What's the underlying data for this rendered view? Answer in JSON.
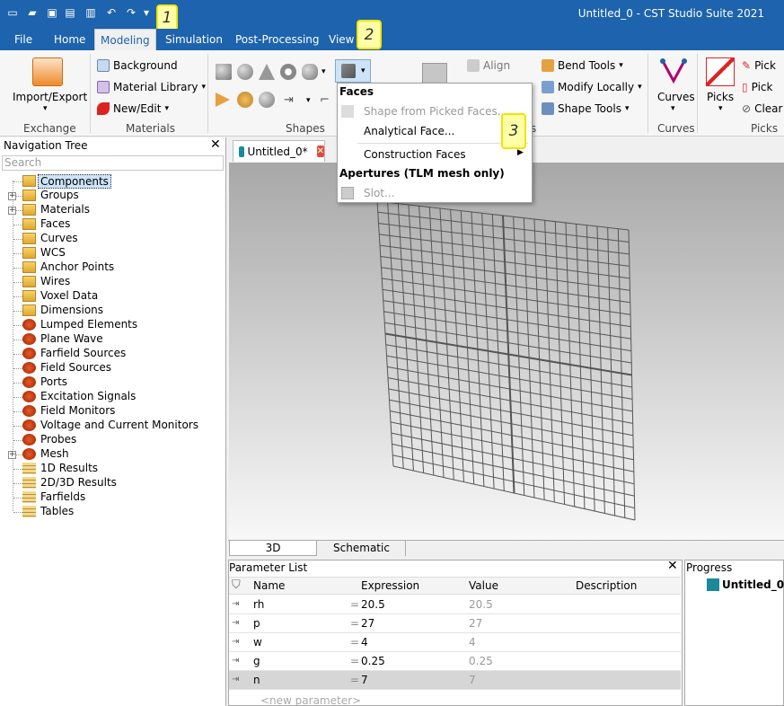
{
  "window": {
    "title": "Untitled_0 - CST Studio Suite 2021"
  },
  "annotations": {
    "one": "1",
    "two": "2",
    "three": "3"
  },
  "menu": [
    "File",
    "Home",
    "Modeling",
    "Simulation",
    "Post-Processing",
    "View"
  ],
  "ribbon": {
    "import_export": "Import/Export",
    "background": "Background",
    "material_library": "Material Library",
    "new_edit": "New/Edit",
    "align": "Align",
    "bend_tools": "Bend Tools",
    "modify_locally": "Modify Locally",
    "shape_tools": "Shape Tools",
    "curves": "Curves",
    "picks": "Picks",
    "pick1": "Pick",
    "pick2": "Pick",
    "clear": "Clear",
    "groups": {
      "exchange": "Exchange",
      "materials": "Materials",
      "shapes": "Shapes",
      "curves": "Curves",
      "picks": "Picks",
      "tools_tail": "s"
    }
  },
  "dropdown": {
    "header": "Faces",
    "items": [
      "Shape from Picked Faces...",
      "Analytical Face...",
      "Construction Faces"
    ],
    "header2": "Apertures (TLM mesh only)",
    "slot": "Slot..."
  },
  "nav": {
    "title": "Navigation Tree",
    "search_placeholder": "Search",
    "items": [
      "Components",
      "Groups",
      "Materials",
      "Faces",
      "Curves",
      "WCS",
      "Anchor Points",
      "Wires",
      "Voxel Data",
      "Dimensions",
      "Lumped Elements",
      "Plane Wave",
      "Farfield Sources",
      "Field Sources",
      "Ports",
      "Excitation Signals",
      "Field Monitors",
      "Voltage and Current Monitors",
      "Probes",
      "Mesh",
      "1D Results",
      "2D/3D Results",
      "Farfields",
      "Tables"
    ]
  },
  "doc_tab": "Untitled_0*",
  "view_tabs": [
    "3D",
    "Schematic"
  ],
  "params": {
    "title": "Parameter List",
    "headers": [
      "Name",
      "Expression",
      "Value",
      "Description"
    ],
    "rows": [
      {
        "name": "rh",
        "expr": "20.5",
        "value": "20.5"
      },
      {
        "name": "p",
        "expr": "27",
        "value": "27"
      },
      {
        "name": "w",
        "expr": "4",
        "value": "4"
      },
      {
        "name": "g",
        "expr": "0.25",
        "value": "0.25"
      },
      {
        "name": "n",
        "expr": "7",
        "value": "7"
      }
    ],
    "eq": "=",
    "new_param": "<new parameter>"
  },
  "progress": {
    "title": "Progress",
    "item": "Untitled_0"
  },
  "colors": {
    "titlebar": "#1d63ad",
    "highlight": "#f2e400"
  }
}
